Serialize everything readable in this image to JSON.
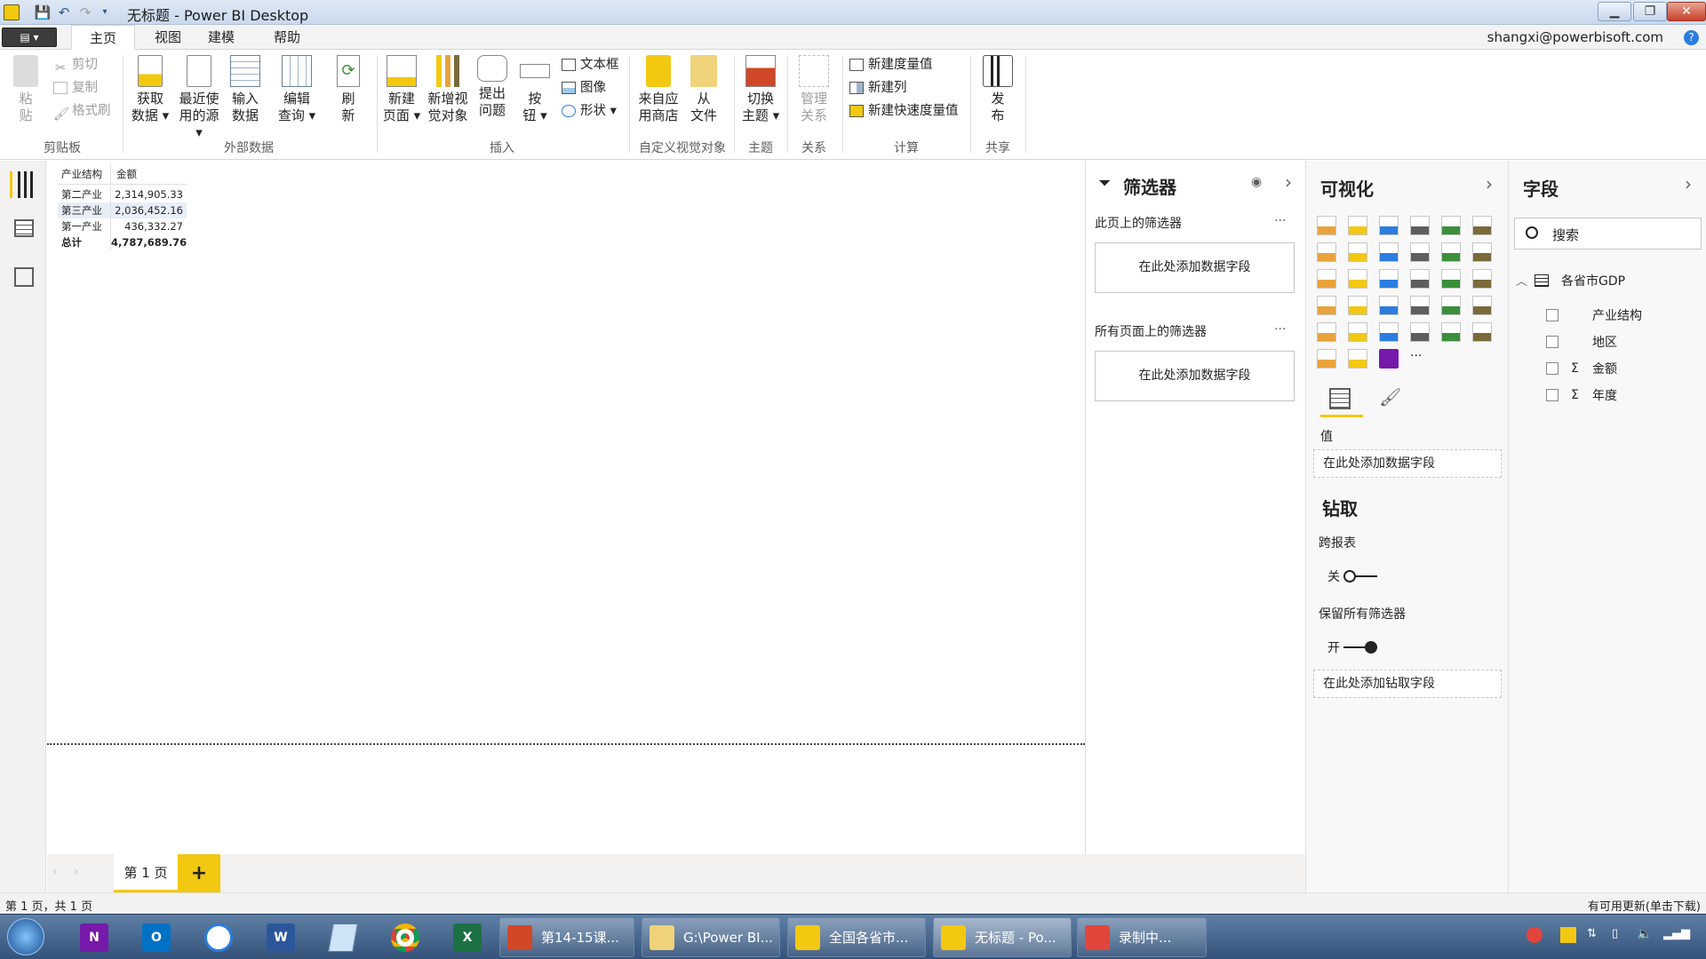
{
  "window": {
    "title": "无标题 - Power BI Desktop"
  },
  "menu": {
    "tabs": [
      "主页",
      "视图",
      "建模",
      "帮助"
    ],
    "user": "shangxi@powerbisoft.com"
  },
  "ribbon": {
    "clipboard": {
      "paste": [
        "粘",
        "贴"
      ],
      "cut": "剪切",
      "copy": "复制",
      "format_painter": "格式刷",
      "label": "剪贴板"
    },
    "external": {
      "get_data": [
        "获取",
        "数据 ▾"
      ],
      "recent": [
        "最近使",
        "用的源 ▾"
      ],
      "enter": [
        "输入",
        "数据"
      ],
      "edit": [
        "编辑",
        "查询 ▾"
      ],
      "refresh": [
        "刷",
        "新"
      ],
      "label": "外部数据"
    },
    "insert": {
      "new_page": [
        "新建",
        "页面 ▾"
      ],
      "new_visual": [
        "新增视",
        "觉对象"
      ],
      "ask": [
        "提出",
        "问题"
      ],
      "buttons": [
        "按",
        "钮 ▾"
      ],
      "textbox": "文本框",
      "image": "图像",
      "shapes": "形状 ▾",
      "label": "插入"
    },
    "custom": {
      "store": [
        "来自应",
        "用商店"
      ],
      "file": [
        "从",
        "文件"
      ],
      "label": "自定义视觉对象"
    },
    "theme": {
      "switch": [
        "切换",
        "主题 ▾"
      ],
      "label": "主题"
    },
    "relations": {
      "manage": [
        "管理",
        "关系"
      ],
      "label": "关系"
    },
    "calc": {
      "new_measure": "新建度量值",
      "new_column": "新建列",
      "quick_measure": "新建快速度量值",
      "label": "计算"
    },
    "share": {
      "publish": [
        "发",
        "布"
      ],
      "label": "共享"
    }
  },
  "table_visual": {
    "headers": [
      "产业结构",
      "金额"
    ],
    "rows": [
      {
        "name": "第二产业",
        "value": "2,314,905.33"
      },
      {
        "name": "第三产业",
        "value": "2,036,452.16"
      },
      {
        "name": "第一产业",
        "value": "436,332.27"
      }
    ],
    "total": {
      "name": "总计",
      "value": "4,787,689.76"
    }
  },
  "pages": {
    "tab1": "第 1 页",
    "add": "+"
  },
  "status": {
    "left": "第 1 页，共 1 页",
    "right": "有可用更新(单击下载)"
  },
  "filters": {
    "title": "筛选器",
    "this_page": "此页上的筛选器",
    "all_pages": "所有页面上的筛选器",
    "add_field": "在此处添加数据字段",
    "more": "···"
  },
  "viz": {
    "title": "可视化",
    "values_label": "值",
    "values_well": "在此处添加数据字段",
    "drill_title": "钻取",
    "cross_report": "跨报表",
    "off": "关",
    "keep_filters": "保留所有筛选器",
    "on": "开",
    "drill_well": "在此处添加钻取字段",
    "more": "···"
  },
  "fields": {
    "title": "字段",
    "search_placeholder": "搜索",
    "table_name": "各省市GDP",
    "items": [
      "产业结构",
      "地区",
      "金额",
      "年度"
    ]
  },
  "taskbar": {
    "windows": [
      "第14-15课...",
      "G:\\Power BI...",
      "全国各省市...",
      "无标题 - Po...",
      "录制中..."
    ]
  },
  "colors": {
    "accent": "#f2c811",
    "excel": "#1d7044",
    "word": "#2b579a",
    "ppt": "#d24726",
    "onenote": "#7719aa",
    "outlook": "#0072c6"
  }
}
